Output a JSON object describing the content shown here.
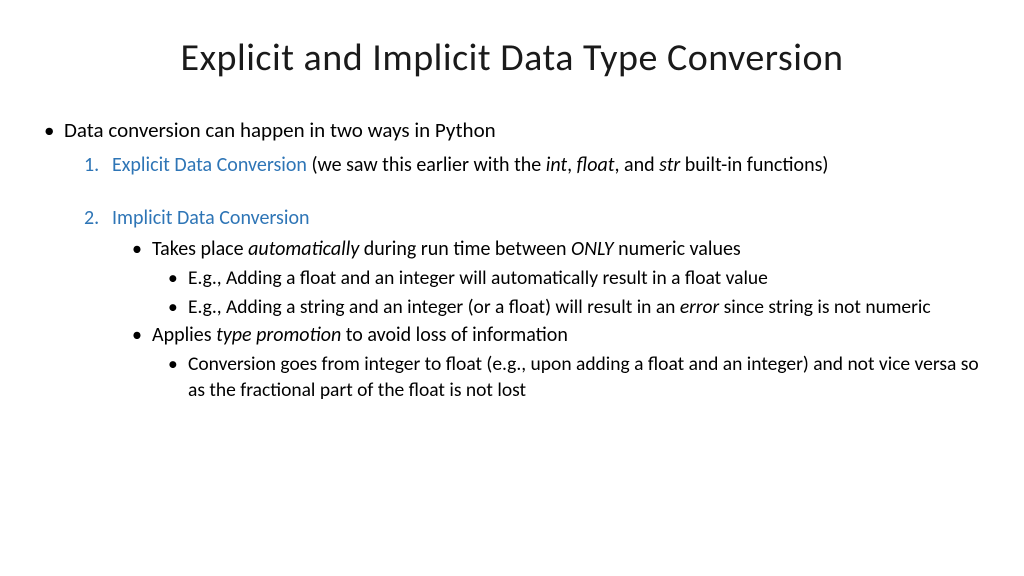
{
  "title": "Explicit and Implicit Data Type Conversion",
  "intro": "Data conversion can happen in two ways in Python",
  "item1": {
    "num": "1.",
    "label": "Explicit Data Conversion",
    "rest_a": " (we saw this earlier with the ",
    "int": "int",
    "comma1": ", ",
    "float": "float",
    "comma2": ", and ",
    "str": "str",
    "rest_b": " built-in functions)"
  },
  "item2": {
    "num": "2.",
    "label": "Implicit Data Conversion"
  },
  "sub1": {
    "a": "Takes place ",
    "auto": "automatically",
    "b": " during run time between ",
    "only": "ONLY",
    "c": " numeric values"
  },
  "eg1": "E.g., Adding a float and an integer will automatically result in a float value",
  "eg2": {
    "a": "E.g., Adding a string and an integer (or a float) will result in an ",
    "error": "error",
    "b": " since string is not numeric"
  },
  "sub2": {
    "a": "Applies ",
    "tp": "type promotion",
    "b": " to avoid loss of information"
  },
  "eg3": "Conversion goes from integer to float (e.g., upon adding a float and an integer) and not vice versa so as the fractional part of the float is not lost"
}
